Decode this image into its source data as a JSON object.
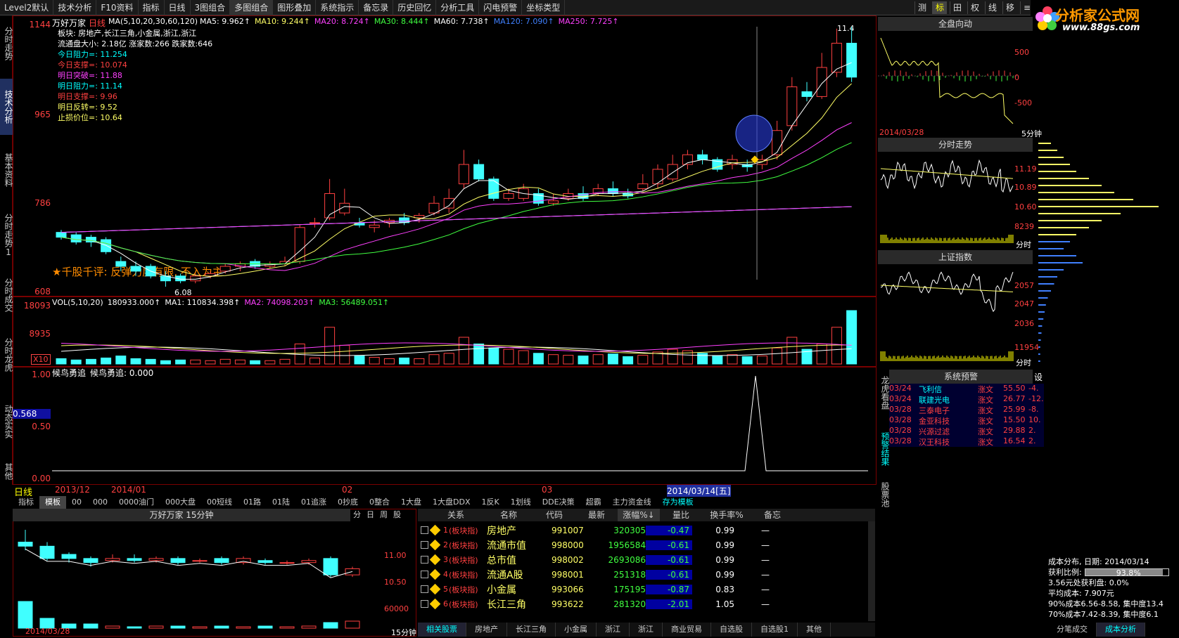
{
  "topmenu": [
    "Level2默认",
    "技术分析",
    "F10资料",
    "指标",
    "日线",
    "3图组合",
    "多图组合",
    "图形叠加",
    "系统指示",
    "备忘录",
    "历史回忆",
    "分析工具",
    "闪电预警",
    "坐标类型"
  ],
  "topright": [
    "测",
    "标",
    "田",
    "权",
    "线",
    "移",
    "≡"
  ],
  "logo": {
    "text": "分析家公式网",
    "url": "www.88gs.com"
  },
  "lefttabs": [
    "分时走势",
    "技术分析",
    "基本资料",
    "分时走势1",
    "分时成交",
    "分时龙虎",
    "动态实实",
    "其他"
  ],
  "main": {
    "title": "万好万家",
    "period": "日线",
    "ma_label": "MA(5,10,20,30,60,120)",
    "ma": [
      {
        "t": "MA5: 9.962↑",
        "c": "#fff"
      },
      {
        "t": "MA10: 9.244↑",
        "c": "#ffff66"
      },
      {
        "t": "MA20: 8.724↑",
        "c": "#ff40ff"
      },
      {
        "t": "MA30: 8.444↑",
        "c": "#40ff40"
      },
      {
        "t": "MA60: 7.738↑",
        "c": "#fff"
      },
      {
        "t": "MA120: 7.090↑",
        "c": "#4080ff"
      },
      {
        "t": "MA250: 7.725↑",
        "c": "#ff40ff"
      }
    ],
    "info": [
      {
        "t": "板块: 房地产,长江三角,小金属,浙江,浙江",
        "c": "#fff"
      },
      {
        "t": "流通盘大小: 2.18亿  涨家数:266   跌家数:646",
        "c": "#fff"
      },
      {
        "t": "今日阻力=: 11.254",
        "c": "#00ffff"
      },
      {
        "t": "今日支撑=: 10.074",
        "c": "#ff4040"
      },
      {
        "t": "明日突破=: 11.88",
        "c": "#ff40ff"
      },
      {
        "t": "明日阻力=: 11.14",
        "c": "#00ffff"
      },
      {
        "t": "明日支撑=: 9.96",
        "c": "#ff4040"
      },
      {
        "t": "明日反转=: 9.52",
        "c": "#ffff66"
      },
      {
        "t": "止损价位=: 10.64",
        "c": "#ffff66"
      }
    ],
    "yaxis": [
      "1144",
      "965",
      "786",
      "608"
    ],
    "lowlabel": "6.08",
    "highlabel": "11.4",
    "comment": "★千股千评: 反弹力度有限, 不入为主"
  },
  "vol": {
    "label": "VOL(5,10,20)",
    "value": "180933.000↑",
    "ma1": "MA1: 110834.398↑",
    "ma2": "MA2: 74098.203↑",
    "ma3": "MA3: 56489.051↑",
    "yaxis": [
      "18093",
      "8935"
    ],
    "x": "X10"
  },
  "ind": {
    "title": "候鸟勇追",
    "label": "候鸟勇追: 0.000",
    "yaxis": [
      "1.00",
      "0.50",
      "0.00"
    ],
    "cur": "0.568"
  },
  "dates": [
    "2013/12",
    "2014/01",
    "02",
    "03",
    "2014/03/14[五]"
  ],
  "periodlabel": "日线",
  "btmtabs": [
    "指标",
    "模板",
    "00",
    "000",
    "0000油门",
    "000大盘",
    "00短线",
    "01路",
    "01陆",
    "01追涨",
    "0抄底",
    "0整合",
    "1大盘",
    "1大盘DDX",
    "1反K",
    "1划线",
    "DDE决策",
    "超霸",
    "主力资金线",
    "存为模板"
  ],
  "mini": {
    "title": "万好万家 15分钟",
    "tabs": [
      "分",
      "日",
      "周",
      "股"
    ],
    "yaxis": [
      "11.00",
      "10.50",
      "60000"
    ],
    "date": "2014/03/28",
    "period": "15分钟"
  },
  "table": {
    "headers": [
      "关系",
      "名称",
      "代码",
      "最新",
      "涨幅%↓",
      "量比",
      "换手率%",
      "备忘"
    ],
    "rows": [
      {
        "n": "1",
        "rel": "(板块指)",
        "name": "房地产",
        "code": "991007",
        "last": "320305",
        "chg": "-0.47",
        "vr": "0.99",
        "to": "—"
      },
      {
        "n": "2",
        "rel": "(板块指)",
        "name": "流通市值",
        "code": "998000",
        "last": "1956584",
        "chg": "-0.61",
        "vr": "0.99",
        "to": "—"
      },
      {
        "n": "3",
        "rel": "(板块指)",
        "name": "总市值",
        "code": "998002",
        "last": "2693086",
        "chg": "-0.61",
        "vr": "0.99",
        "to": "—"
      },
      {
        "n": "4",
        "rel": "(板块指)",
        "name": "流通A股",
        "code": "998001",
        "last": "251318",
        "chg": "-0.61",
        "vr": "0.99",
        "to": "—"
      },
      {
        "n": "5",
        "rel": "(板块指)",
        "name": "小金属",
        "code": "993066",
        "last": "175195",
        "chg": "-0.87",
        "vr": "0.83",
        "to": "—"
      },
      {
        "n": "6",
        "rel": "(板块指)",
        "name": "长江三角",
        "code": "993622",
        "last": "281320",
        "chg": "-2.01",
        "vr": "1.05",
        "to": "—"
      }
    ],
    "btabs": [
      "相关股票",
      "房地产",
      "长江三角",
      "小金属",
      "浙江",
      "浙江",
      "商业贸易",
      "自选股",
      "自选股1",
      "其他"
    ]
  },
  "right": {
    "p1": "全盘向动",
    "p1y": [
      "500",
      "0",
      "-500"
    ],
    "p1date": "2014/03/28",
    "p1per": "5分钟",
    "p2": "分时走势",
    "p2y": [
      "11.19",
      "10.89",
      "10.60",
      "8239"
    ],
    "p2x": "分时",
    "p3": "上证指数",
    "p3y": [
      "2057",
      "2047",
      "2036",
      "11954"
    ],
    "p3x": "分时",
    "p4": "系统预警",
    "p4btn": "设",
    "sidetabs": [
      "龙虎看盘",
      "预警结果",
      "股票池"
    ],
    "warn": [
      {
        "d": "03/24",
        "n": "飞利信",
        "t": "涨文",
        "v": "55.50",
        "p": "-4."
      },
      {
        "d": "03/24",
        "n": "联建光电",
        "t": "涨文",
        "v": "26.77",
        "p": "-12."
      },
      {
        "d": "03/28",
        "n": "三泰电子",
        "t": "涨文",
        "v": "25.99",
        "p": "-8."
      },
      {
        "d": "03/28",
        "n": "金亚科技",
        "t": "涨文",
        "v": "15.50",
        "p": "10."
      },
      {
        "d": "03/28",
        "n": "兴源过滤",
        "t": "涨文",
        "v": "29.88",
        "p": "2."
      },
      {
        "d": "03/28",
        "n": "汉王科技",
        "t": "涨文",
        "v": "16.54",
        "p": "2."
      }
    ]
  },
  "cost": {
    "title": "成本分布, 日期: 2014/03/14",
    "profit": "获利比例:",
    "pct": "93.8%",
    "pctval": 0.938,
    "l1": "3.56元处获利盘: 0.0%",
    "l2": "平均成本: 7.907元",
    "l3": "90%成本6.56-8.58, 集中度13.4",
    "l4": "70%成本7.42-8.39, 集中度6.1",
    "tabs": [
      "分笔成交",
      "成本分析"
    ]
  }
}
